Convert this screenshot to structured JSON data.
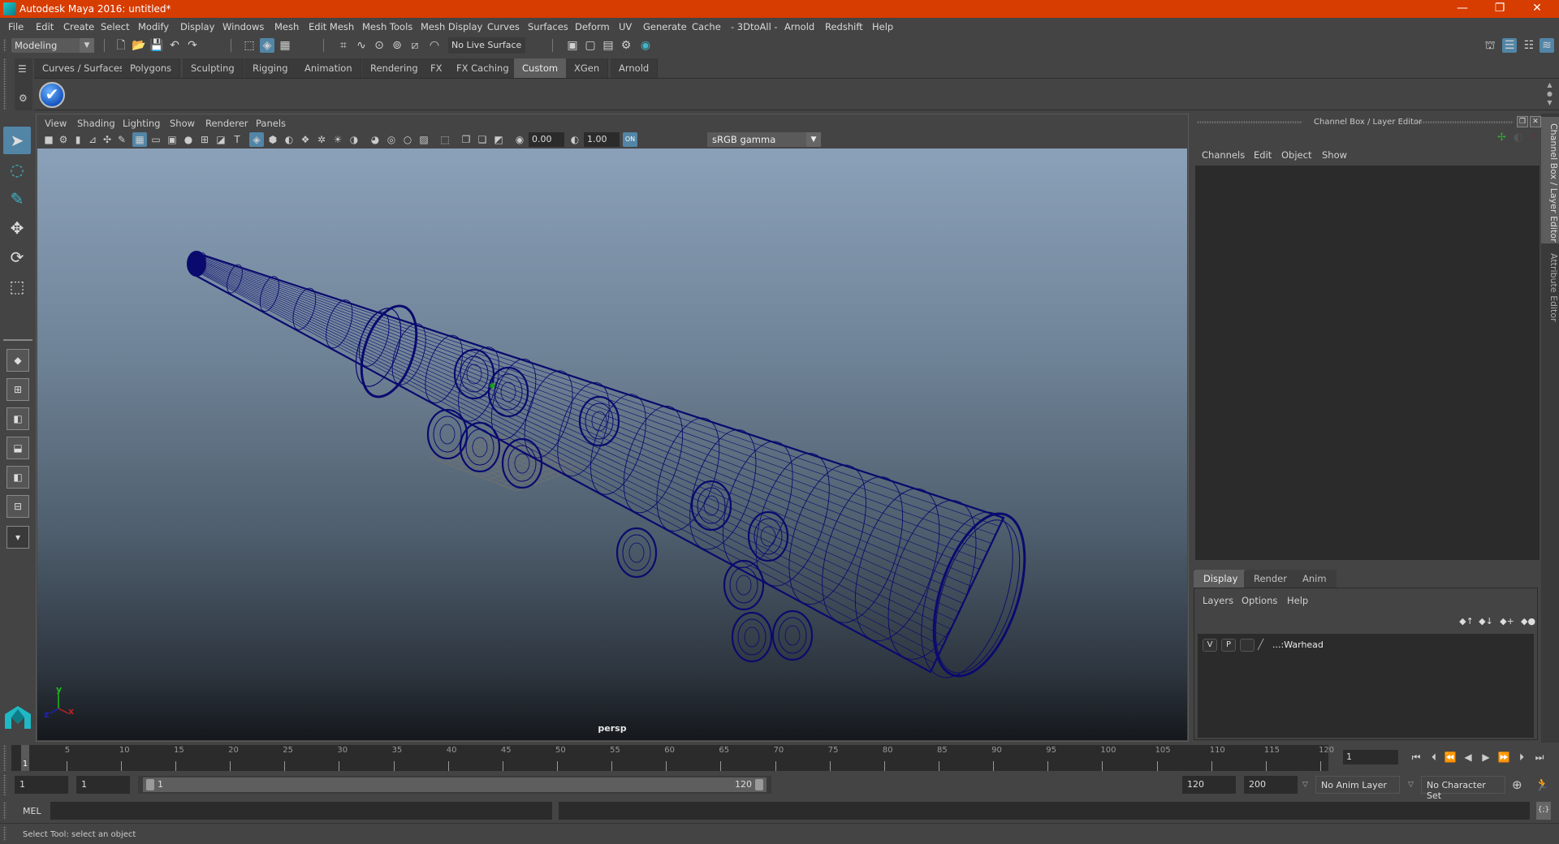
{
  "window": {
    "title": "Autodesk Maya 2016: untitled*",
    "controls": {
      "minimize": "—",
      "maximize": "❐",
      "close": "✕"
    },
    "accent_color": "#d73c00"
  },
  "menubar": [
    "File",
    "Edit",
    "Create",
    "Select",
    "Modify",
    "Display",
    "Windows",
    "Mesh",
    "Edit Mesh",
    "Mesh Tools",
    "Mesh Display",
    "Curves",
    "Surfaces",
    "Deform",
    "UV",
    "Generate",
    "Cache",
    "- 3DtoAll -",
    "Arnold",
    "Redshift",
    "Help"
  ],
  "statusline": {
    "mode": "Modeling",
    "live_surface": "No Live Surface",
    "icons": [
      "new-scene-icon",
      "open-scene-icon",
      "save-scene-icon",
      "undo-icon",
      "redo-icon",
      "select-by-hierarchy-icon",
      "select-by-object-icon",
      "select-by-component-icon",
      "snap-grid-icon",
      "snap-curve-icon",
      "snap-point-icon",
      "snap-projected-center-icon",
      "snap-view-plane-icon",
      "make-live-icon",
      "render-history-icon",
      "render-frame-icon",
      "ipr-render-icon",
      "render-settings-icon",
      "hypershade-icon"
    ],
    "right_icons": [
      "modeling-toolkit-icon",
      "attribute-editor-toggle-icon",
      "tool-settings-toggle-icon",
      "channel-box-toggle-icon"
    ]
  },
  "shelf": {
    "tabs": [
      "Curves / Surfaces",
      "Polygons",
      "Sculpting",
      "Rigging",
      "Animation",
      "Rendering",
      "FX",
      "FX Caching",
      "Custom",
      "XGen",
      "Arnold"
    ],
    "active_tab": "Custom",
    "buttons": [
      {
        "name": "checkmark-shelf-button",
        "glyph": "✔"
      }
    ]
  },
  "toolbox": {
    "tools": [
      {
        "name": "select-tool",
        "glyph": "➤",
        "active": true
      },
      {
        "name": "lasso-tool",
        "glyph": "◌"
      },
      {
        "name": "paint-select-tool",
        "glyph": "✎"
      },
      {
        "name": "move-tool",
        "glyph": "✥"
      },
      {
        "name": "rotate-tool",
        "glyph": "⟳"
      },
      {
        "name": "scale-tool",
        "glyph": "⬚"
      }
    ],
    "layouts": [
      "single-perspective-layout",
      "four-view-layout",
      "persp-outliner-layout",
      "persp-graph-layout",
      "hypershade-persp-layout",
      "persp-graph-hypergraph-layout"
    ],
    "more": "▾"
  },
  "viewport": {
    "menu": [
      "View",
      "Shading",
      "Lighting",
      "Show",
      "Renderer",
      "Panels"
    ],
    "exposure": "0.00",
    "gamma": "1.00",
    "color_space": "sRGB gamma",
    "camera_label": "persp",
    "axis": {
      "x": "x",
      "y": "y",
      "z": "z"
    },
    "wire_color": "#0a0a6e"
  },
  "channel_box": {
    "title": "Channel Box / Layer Editor",
    "menu": [
      "Channels",
      "Edit",
      "Object",
      "Show"
    ],
    "layer_tabs": [
      "Display",
      "Render",
      "Anim"
    ],
    "active_layer_tab": "Display",
    "layer_menu": [
      "Layers",
      "Options",
      "Help"
    ],
    "layers": [
      {
        "visible": "V",
        "playback": "P",
        "name": "...:Warhead"
      }
    ]
  },
  "side_tabs": [
    "Channel Box / Layer Editor",
    "Attribute Editor"
  ],
  "timeslider": {
    "ticks": [
      5,
      10,
      15,
      20,
      25,
      30,
      35,
      40,
      45,
      50,
      55,
      60,
      65,
      70,
      75,
      80,
      85,
      90,
      95,
      100,
      105,
      110,
      115,
      120
    ],
    "start": 1,
    "end": 120,
    "current_frame": "1"
  },
  "playback": {
    "current_frame_field": "1",
    "buttons": [
      "go-to-start-icon",
      "step-back-key-icon",
      "step-back-frame-icon",
      "play-backward-icon",
      "play-forward-icon",
      "step-forward-frame-icon",
      "step-forward-key-icon",
      "go-to-end-icon"
    ]
  },
  "range": {
    "start_time": "1",
    "playback_start": "1",
    "range_start_label": "1",
    "range_end_label": "120",
    "playback_end": "120",
    "end_time": "200",
    "anim_layer": "No Anim Layer",
    "character_set": "No Character Set"
  },
  "command": {
    "language": "MEL",
    "input_value": ""
  },
  "helpline": "Select Tool: select an object"
}
